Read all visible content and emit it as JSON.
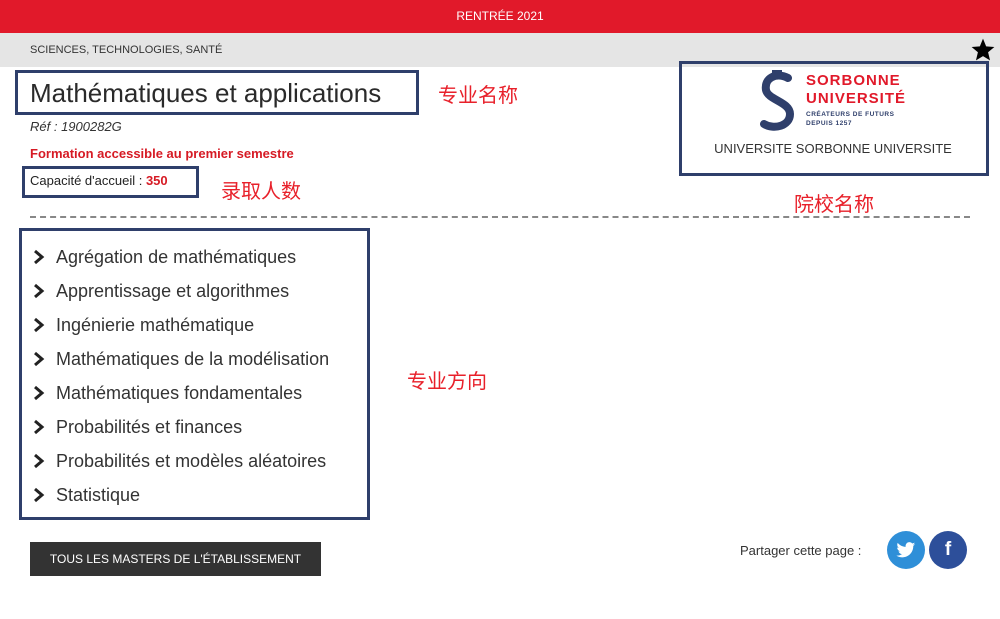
{
  "header": {
    "rentree": "RENTRÉE 2021",
    "domain": "SCIENCES, TECHNOLOGIES, SANTÉ"
  },
  "program": {
    "title": "Mathématiques et applications",
    "ref": "Réf : 1900282G",
    "semester_note": "Formation accessible au premier semestre",
    "capacity_label": "Capacité d'accueil : ",
    "capacity_value": "350"
  },
  "institution": {
    "logo_line1": "SORBONNE",
    "logo_line2": "UNIVERSITÉ",
    "logo_tag1": "CRÉATEURS DE FUTURS",
    "logo_tag2": "DEPUIS 1257",
    "name": "UNIVERSITE SORBONNE UNIVERSITE"
  },
  "annotations": {
    "program_name": "专业名称",
    "capacity": "录取人数",
    "institution": "院校名称",
    "tracks": "专业方向"
  },
  "tracks": [
    "Agrégation de mathématiques",
    "Apprentissage et algorithmes",
    "Ingénierie mathématique",
    "Mathématiques de la modélisation",
    "Mathématiques fondamentales",
    "Probabilités et finances",
    "Probabilités et modèles aléatoires",
    "Statistique"
  ],
  "actions": {
    "all_masters": "TOUS LES MASTERS DE L'ÉTABLISSEMENT",
    "share_label": "Partager cette page :",
    "facebook_glyph": "f"
  },
  "colors": {
    "brand_red": "#e1192a",
    "navy": "#2f3f6b",
    "twitter": "#2f8fd8",
    "facebook": "#2d4f9a"
  }
}
